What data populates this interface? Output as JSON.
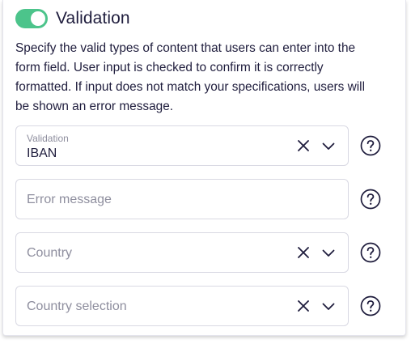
{
  "section": {
    "title": "Validation",
    "toggle_on": true,
    "accent_color": "#4cc48b",
    "description": "Specify the valid types of content that users can enter into the form field. User input is checked to confirm it is correctly formatted. If input does not match your specifications, users will be shown an error message."
  },
  "fields": {
    "validation": {
      "label": "Validation",
      "value": "IBAN"
    },
    "error_message": {
      "placeholder": "Error message"
    },
    "country": {
      "placeholder": "Country"
    },
    "country_selection": {
      "placeholder": "Country selection"
    }
  },
  "icons": {
    "clear": "close-icon",
    "dropdown": "chevron-down-icon",
    "help": "question-circle-icon"
  }
}
